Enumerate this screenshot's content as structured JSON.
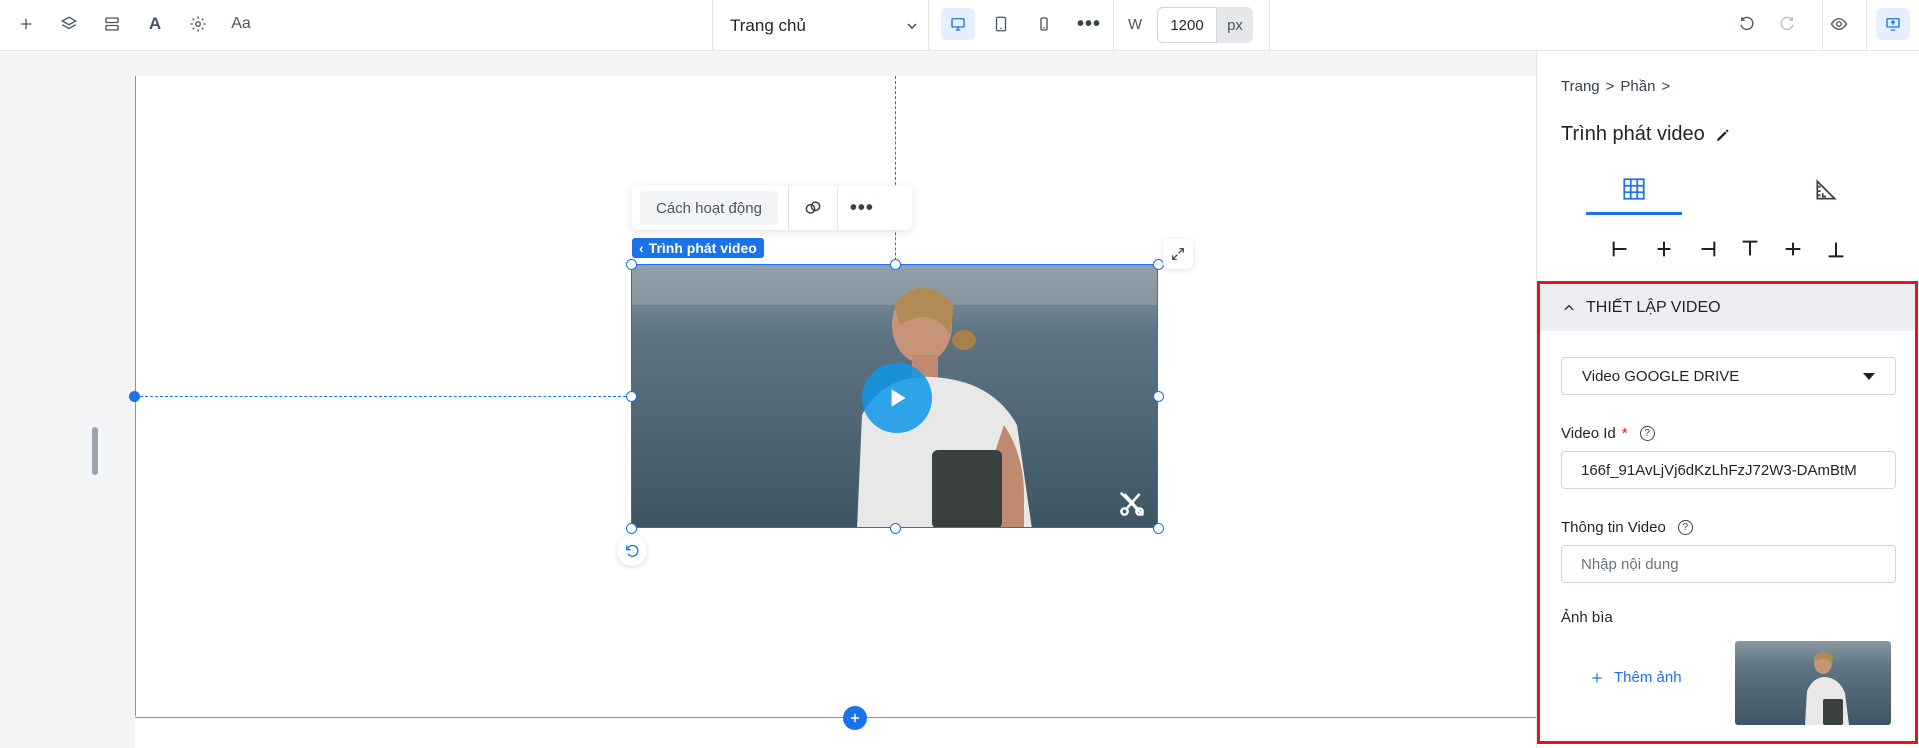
{
  "toolbar": {
    "font_label": "A",
    "typography_label": "Aa",
    "page_name": "Trang chủ",
    "width_label": "W",
    "width_value": "1200",
    "width_unit": "px"
  },
  "canvas": {
    "float_toolbar": {
      "mode_label": "Cách hoạt động"
    },
    "element_tag": "Trình phát video"
  },
  "panel": {
    "breadcrumb": [
      "Trang",
      ">",
      "Phần",
      ">"
    ],
    "title": "Trình phát video",
    "settings": {
      "header": "THIẾT LẬP VIDEO",
      "source_select": "Video GOOGLE DRIVE",
      "video_id_label": "Video Id",
      "video_id_required": "*",
      "video_id_value": "166f_91AvLjVj6dKzLhFzJ72W3-DAmBtM",
      "info_label": "Thông tin Video",
      "info_placeholder": "Nhập nội dung",
      "cover_label": "Ảnh bìa",
      "add_image_label": "Thêm ảnh"
    }
  },
  "colors": {
    "accent": "#1a73e8",
    "highlight_border": "#e3161a",
    "section_line": "#34c38f"
  }
}
